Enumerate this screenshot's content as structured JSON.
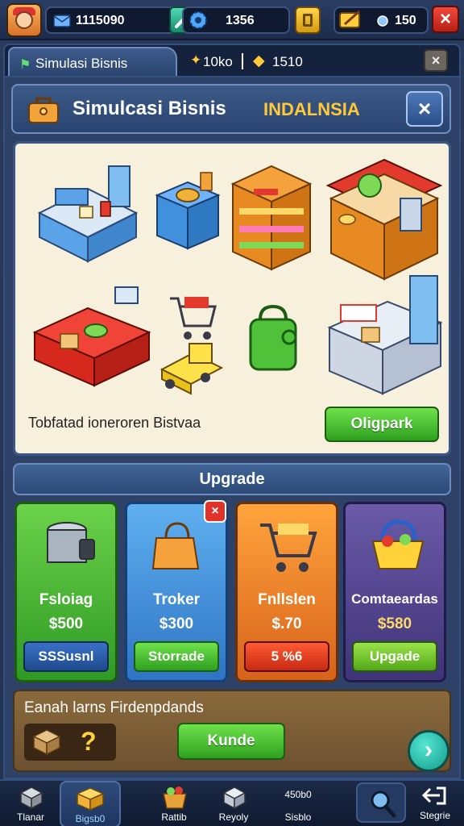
{
  "topbar": {
    "gems_value": "1115090",
    "gear_value": "1356",
    "coins_value": "150"
  },
  "tabstrip": {
    "tab_label": "Simulasi Bisnis",
    "stat1": "10ko",
    "stat2": "1510"
  },
  "title": {
    "main": "Simulcasi Bisnis",
    "accent": "INDALNSIA"
  },
  "showcase": {
    "caption": "Tobfatad ioneroren Bistvaa",
    "button_label": "Oligpark"
  },
  "upgrade": {
    "header": "Upgrade",
    "cards": [
      {
        "name": "Fsloiag",
        "price": "$500",
        "button": "SSSusnl",
        "color": "green"
      },
      {
        "name": "Troker",
        "price": "$300",
        "button": "Storrade",
        "color": "blue"
      },
      {
        "name": "Fnllslen",
        "price": "$.70",
        "button": "5 %6",
        "color": "orange"
      },
      {
        "name": "Comtaeardas",
        "price": "$580",
        "button": "Upgade",
        "color": "purple"
      }
    ]
  },
  "bottom_panel": {
    "title": "Eanah larns Firdenpdands",
    "button": "Kunde"
  },
  "nav": {
    "items": [
      {
        "label": "Tlanar",
        "icon": "box-icon"
      },
      {
        "label": "Bigsb0",
        "icon": "gift-box-icon"
      },
      {
        "label": "Rattib",
        "icon": "basket-icon"
      },
      {
        "label": "Reyoly",
        "icon": "cube-icon"
      },
      {
        "label": "Sisblo",
        "icon": "crates-icon",
        "extra": "450b0"
      },
      {
        "label": "",
        "icon": "search-icon"
      },
      {
        "label": "Stegrie",
        "icon": "exit-arrow-icon"
      }
    ]
  },
  "colors": {
    "accent_yellow": "#ffc93a",
    "green": "#2ea01f",
    "red": "#e03228",
    "teal": "#139c8a"
  }
}
